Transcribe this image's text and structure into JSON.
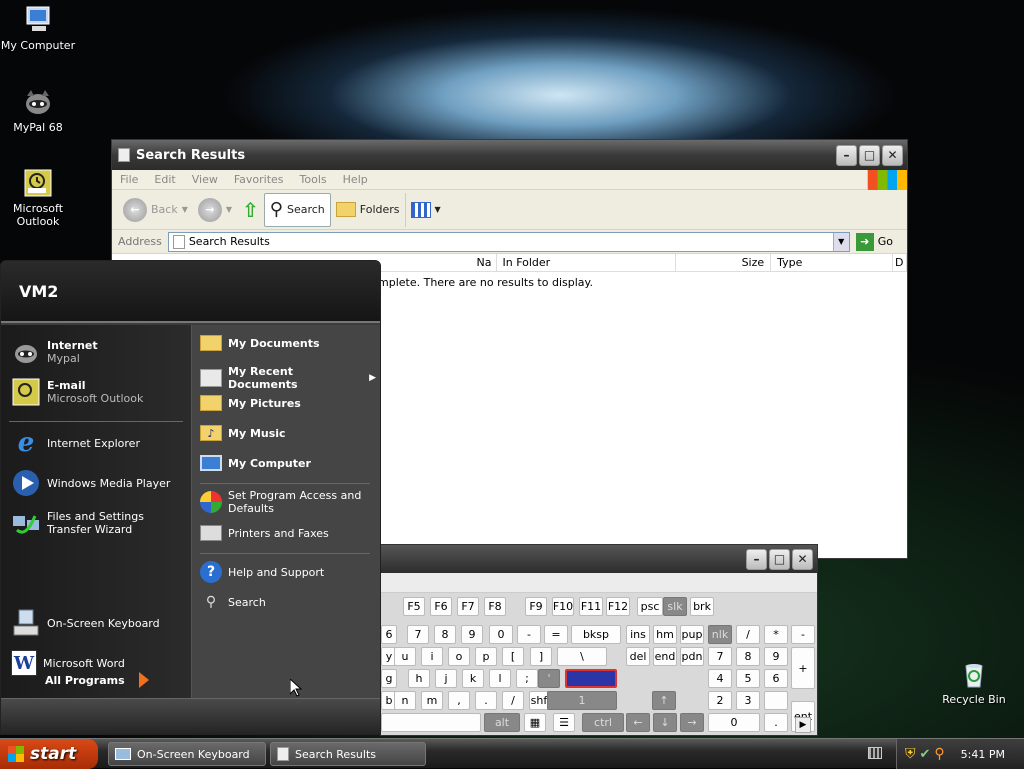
{
  "desktop": {
    "icons": [
      {
        "label": "My Computer",
        "icon": "computer-icon"
      },
      {
        "label": "MyPal 68",
        "icon": "mypal-raccoon-icon"
      },
      {
        "label": "Microsoft Outlook",
        "icon": "outlook-icon"
      },
      {
        "label": "Recycle Bin",
        "icon": "recycle-bin-icon"
      }
    ]
  },
  "search_window": {
    "title": "Search Results",
    "menu": [
      "File",
      "Edit",
      "View",
      "Favorites",
      "Tools",
      "Help"
    ],
    "toolbar": {
      "back": "Back",
      "search": "Search",
      "folders": "Folders"
    },
    "address_label": "Address",
    "address_value": "Search Results",
    "go": "Go",
    "columns": [
      "Na",
      "In Folder",
      "Size",
      "Type",
      "D"
    ],
    "message": "mplete. There are no results to display."
  },
  "start_menu": {
    "user": "VM2",
    "pinned": [
      {
        "title": "Internet",
        "subtitle": "Mypal",
        "icon": "mypal-raccoon-icon"
      },
      {
        "title": "E-mail",
        "subtitle": "Microsoft Outlook",
        "icon": "outlook-icon"
      }
    ],
    "recent": [
      {
        "label": "Internet Explorer",
        "icon": "internet-explorer-icon"
      },
      {
        "label": "Windows Media Player",
        "icon": "media-player-icon"
      },
      {
        "label": "Files and Settings Transfer Wizard",
        "icon": "transfer-wizard-icon"
      },
      {
        "label": "On-Screen Keyboard",
        "icon": "keyboard-icon"
      },
      {
        "label": "Microsoft Word",
        "icon": "word-icon"
      }
    ],
    "all_programs": "All Programs",
    "places": [
      {
        "label": "My Documents",
        "icon": "folder-icon"
      },
      {
        "label": "My Recent Documents",
        "icon": "recent-documents-icon"
      },
      {
        "label": "My Pictures",
        "icon": "pictures-folder-icon"
      },
      {
        "label": "My Music",
        "icon": "music-folder-icon"
      },
      {
        "label": "My Computer",
        "icon": "computer-icon"
      }
    ],
    "settings": [
      {
        "label": "Set Program Access and Defaults",
        "icon": "program-access-icon"
      },
      {
        "label": "Printers and Faxes",
        "icon": "printer-icon"
      }
    ],
    "help": [
      {
        "label": "Help and Support",
        "icon": "help-icon"
      },
      {
        "label": "Search",
        "icon": "search-icon"
      }
    ]
  },
  "osk": {
    "row0": [
      "F5",
      "F6",
      "F7",
      "F8",
      "F9",
      "F10",
      "F11",
      "F12",
      "psc",
      "slk",
      "brk"
    ],
    "row1": [
      "6",
      "7",
      "8",
      "9",
      "0",
      "-",
      "=",
      "bksp",
      "ins",
      "hm",
      "pup",
      "nlk",
      "/",
      "*",
      "-"
    ],
    "row2": [
      "y",
      "u",
      "i",
      "o",
      "p",
      "[",
      "]",
      "\\",
      "del",
      "end",
      "pdn",
      "7",
      "8",
      "9",
      "+"
    ],
    "row3": [
      "g",
      "h",
      "j",
      "k",
      "l",
      ";",
      "'",
      "ent",
      "4",
      "5",
      "6"
    ],
    "row4": [
      "b",
      "n",
      "m",
      ",",
      ".",
      "/",
      "shft",
      "1",
      "2",
      "3"
    ],
    "row5": [
      "alt",
      "ctrl",
      "0",
      ".",
      "ent"
    ]
  },
  "taskbar": {
    "start": "start",
    "tasks": [
      "On-Screen Keyboard",
      "Search Results"
    ],
    "clock": "5:41 PM"
  },
  "colors": {
    "start_button": "#c13b0d",
    "osk_selected_key": "#2b35a6"
  }
}
